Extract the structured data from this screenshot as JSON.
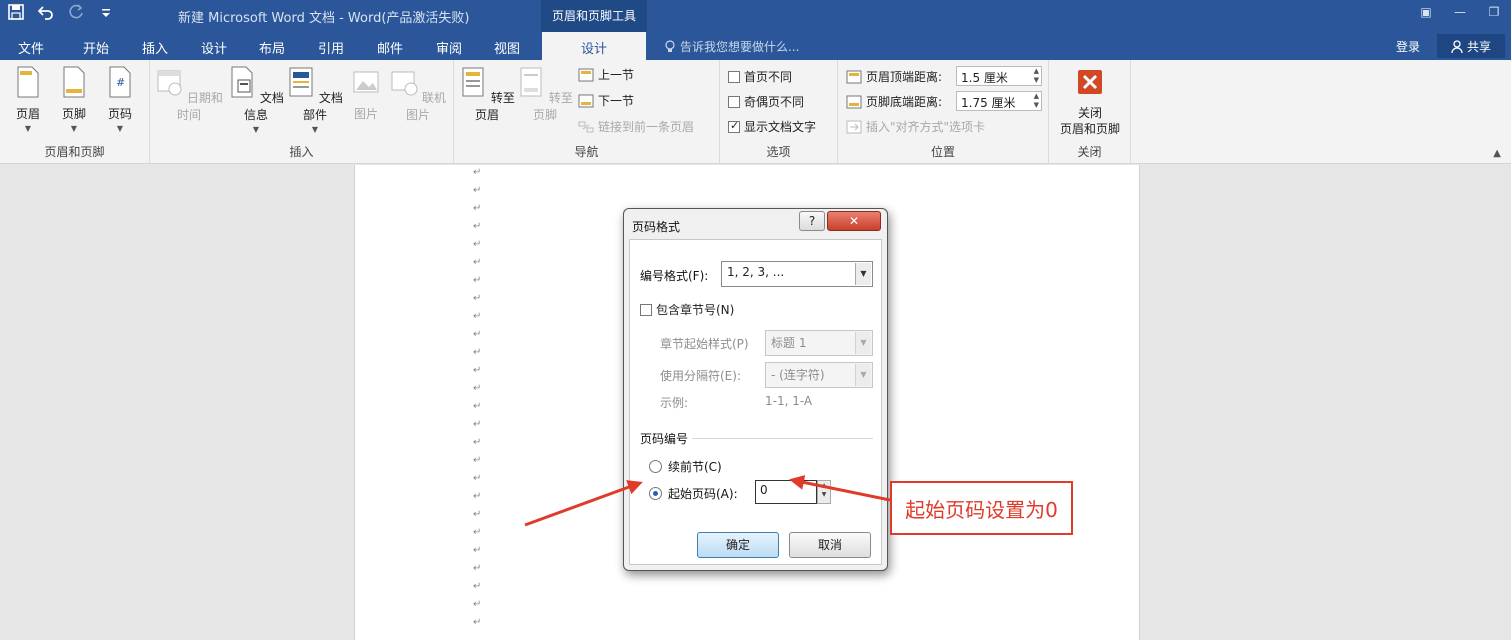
{
  "titlebar": {
    "doc_title": "新建 Microsoft Word 文档 - Word(产品激活失败)",
    "contextual_tab": "页眉和页脚工具",
    "icons": [
      "save-icon",
      "undo-icon",
      "redo-icon",
      "customize-qat-icon",
      "ribbon-display-icon",
      "minimize-icon",
      "restore-icon"
    ]
  },
  "tabs": [
    "文件",
    "开始",
    "插入",
    "设计",
    "布局",
    "引用",
    "邮件",
    "审阅",
    "视图",
    "设计"
  ],
  "active_tab": "设计",
  "tell_me": "告诉我您想要做什么...",
  "login": "登录",
  "share": "共享",
  "ribbon": {
    "group_header_footer": {
      "label": "页眉和页脚",
      "buttons": [
        "页眉",
        "页脚",
        "页码"
      ]
    },
    "group_insert": {
      "label": "插入",
      "buttons": [
        "日期和时间",
        "文档信息",
        "文档部件",
        "图片",
        "联机图片"
      ]
    },
    "group_nav": {
      "label": "导航",
      "goto_header": "转至页眉",
      "goto_footer": "转至页脚",
      "prev": "上一节",
      "next": "下一节",
      "link_prev": "链接到前一条页眉"
    },
    "group_options": {
      "label": "选项",
      "first_page": "首页不同",
      "odd_even": "奇偶页不同",
      "show_text": "显示文档文字"
    },
    "group_position": {
      "label": "位置",
      "header_top_label": "页眉顶端距离:",
      "header_top_value": "1.5 厘米",
      "footer_bottom_label": "页脚底端距离:",
      "footer_bottom_value": "1.75 厘米",
      "insert_align_tab": "插入\"对齐方式\"选项卡"
    },
    "group_close": {
      "label": "关闭",
      "button_line1": "关闭",
      "button_line2": "页眉和页脚"
    }
  },
  "document": {
    "paragraph_mark": "↵"
  },
  "dialog": {
    "title": "页码格式",
    "help": "?",
    "close": "✕",
    "number_format_label": "编号格式(F):",
    "number_format_value": "1, 2, 3, ...",
    "include_chapter_label": "包含章节号(N)",
    "chapter_style_label": "章节起始样式(P)",
    "chapter_style_value": "标题 1",
    "separator_label": "使用分隔符(E):",
    "separator_value": "-  (连字符)",
    "example_label": "示例:",
    "example_value": "1-1, 1-A",
    "page_numbering_label": "页码编号",
    "continue_label": "续前节(C)",
    "start_at_label": "起始页码(A):",
    "start_at_value": "0",
    "ok": "确定",
    "cancel": "取消"
  },
  "annotation": {
    "text": "起始页码设置为0",
    "color": "#e03a2b"
  },
  "colors": {
    "brand": "#2b579a",
    "ribbon_bg": "#f3f3f3",
    "canvas_bg": "#e6e6e6"
  }
}
